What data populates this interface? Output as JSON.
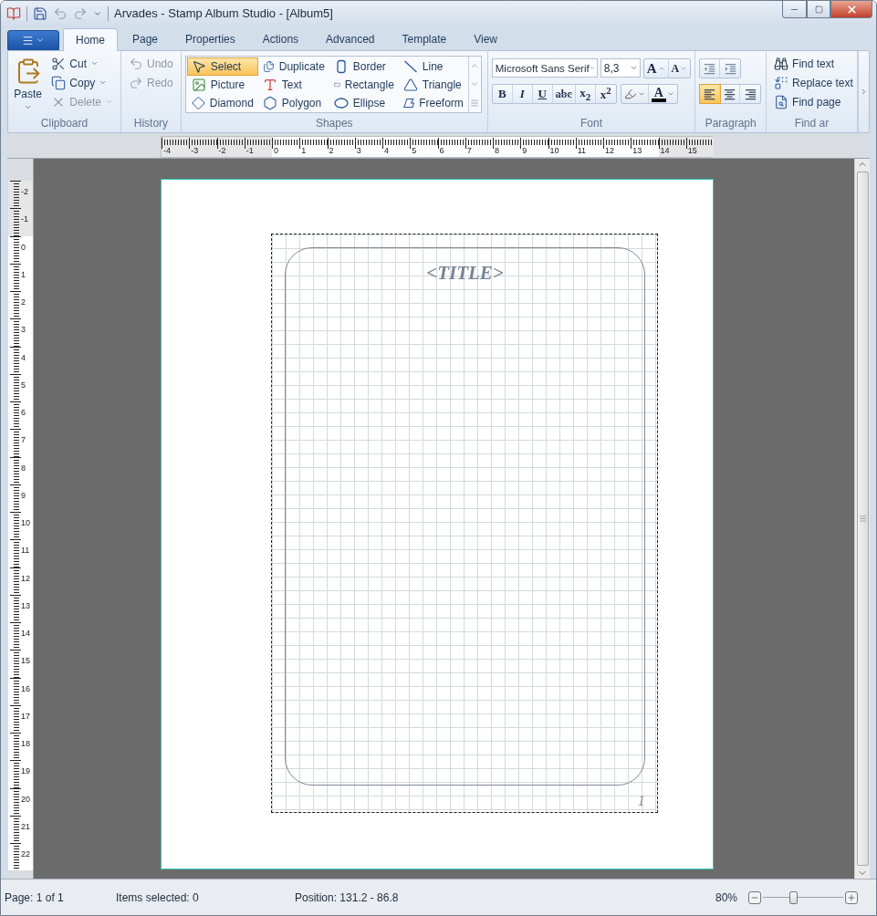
{
  "window": {
    "title": "Arvades - Stamp Album Studio - [Album5]"
  },
  "tabs": [
    {
      "label": "Home",
      "selected": true
    },
    {
      "label": "Page",
      "selected": false
    },
    {
      "label": "Properties",
      "selected": false
    },
    {
      "label": "Actions",
      "selected": false
    },
    {
      "label": "Advanced",
      "selected": false
    },
    {
      "label": "Template",
      "selected": false
    },
    {
      "label": "View",
      "selected": false
    }
  ],
  "ribbon": [
    {
      "kind": "clipboard",
      "label": "Clipboard",
      "paste": "Paste",
      "items": [
        {
          "label": "Cut",
          "disabled": false
        },
        {
          "label": "Copy",
          "disabled": false
        },
        {
          "label": "Delete",
          "disabled": true
        }
      ]
    },
    {
      "kind": "history",
      "label": "History",
      "items": [
        {
          "label": "Undo",
          "disabled": true
        },
        {
          "label": "Redo",
          "disabled": true
        }
      ]
    },
    {
      "kind": "shapes",
      "label": "Shapes",
      "items": [
        {
          "label": "Select",
          "selected": true
        },
        {
          "label": "Duplicate",
          "selected": false
        },
        {
          "label": "Border",
          "selected": false
        },
        {
          "label": "Line",
          "selected": false
        },
        {
          "label": "Picture",
          "selected": false
        },
        {
          "label": "Text",
          "selected": false
        },
        {
          "label": "Rectangle",
          "selected": false
        },
        {
          "label": "Triangle",
          "selected": false
        },
        {
          "label": "Diamond",
          "selected": false
        },
        {
          "label": "Polygon",
          "selected": false
        },
        {
          "label": "Ellipse",
          "selected": false
        },
        {
          "label": "Freeform",
          "selected": false
        }
      ]
    },
    {
      "kind": "font",
      "label": "Font",
      "font_name": "Microsoft Sans Serif",
      "font_size": "8,3",
      "size_buttons": [
        "A",
        "A"
      ],
      "styles": [
        "B",
        "I",
        "U",
        "abc",
        "x$_{2}$",
        "x$^{2}$"
      ],
      "font_color": "A"
    },
    {
      "kind": "paragraph",
      "label": "Paragraph",
      "alignments": [
        {
          "selected": true
        },
        {
          "selected": false
        },
        {
          "selected": false
        }
      ]
    },
    {
      "kind": "find",
      "label": "Find ar",
      "items": [
        "Find text",
        "Replace text",
        "Find page"
      ]
    }
  ],
  "ruler_horizontal": {
    "before": [
      "-4",
      "-3",
      "-2",
      "-1"
    ],
    "page": [
      "0",
      "1",
      "2",
      "3",
      "4",
      "5",
      "6",
      "7",
      "8",
      "9",
      "10",
      "11",
      "12",
      "13"
    ],
    "after": [
      "14",
      "15"
    ]
  },
  "ruler_vertical": {
    "before": [
      "-2",
      "-1"
    ],
    "page": [
      "0",
      "1",
      "2",
      "3",
      "4",
      "5",
      "6",
      "7",
      "8",
      "9",
      "10",
      "11",
      "12",
      "13",
      "14",
      "15",
      "16",
      "17",
      "18",
      "19",
      "20",
      "21",
      "22"
    ]
  },
  "page": {
    "title": "<TITLE>",
    "page_number": "1"
  },
  "status_bar": {
    "page": "Page: 1 of 1",
    "items_selected": "Items selected: 0",
    "position": "Position: 131.2 - 86.8",
    "zoom": "80%",
    "zoom_slider": {
      "level": 0.37
    }
  }
}
